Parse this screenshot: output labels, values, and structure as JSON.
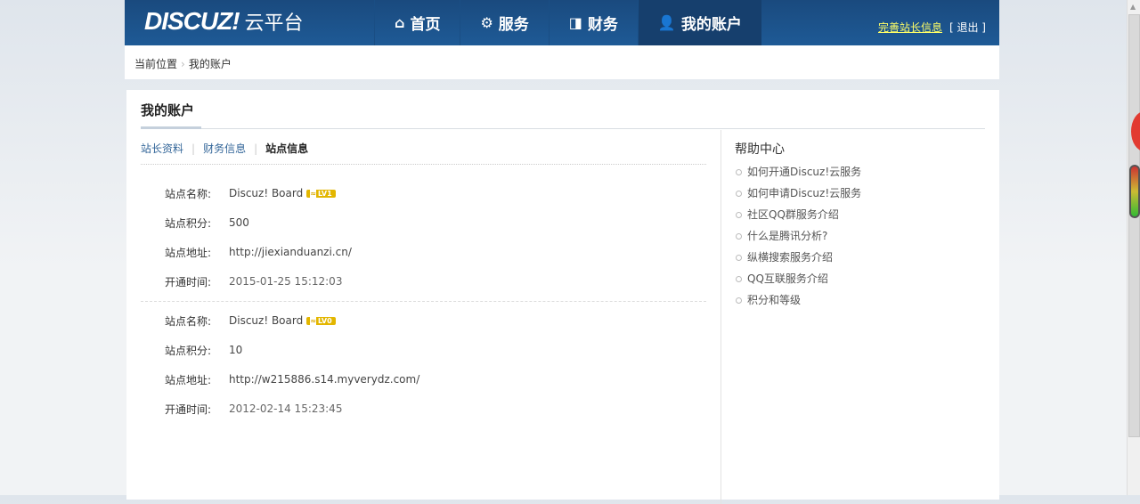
{
  "header": {
    "logo": "DISCUZ!",
    "logo_sub": "云平台",
    "nav": [
      {
        "label": "首页",
        "icon": "home-icon",
        "glyph": "⌂"
      },
      {
        "label": "服务",
        "icon": "gear-icon",
        "glyph": "⚙"
      },
      {
        "label": "财务",
        "icon": "wallet-icon",
        "glyph": "◨"
      },
      {
        "label": "我的账户",
        "icon": "user-icon",
        "glyph": "👤"
      }
    ],
    "complete_info": "完善站长信息",
    "logout": "[ 退出 ]"
  },
  "breadcrumb": {
    "prefix": "当前位置",
    "sep": "›",
    "current": "我的账户"
  },
  "page": {
    "title": "我的账户"
  },
  "tabs": [
    "站长资料",
    "财务信息",
    "站点信息"
  ],
  "labels": {
    "name": "站点名称:",
    "score": "站点积分:",
    "url": "站点地址:",
    "time": "开通时间:"
  },
  "sites": [
    {
      "name": "Discuz! Board",
      "level": "LV1",
      "score": "500",
      "url": "http://jiexianduanzi.cn/",
      "time": "2015-01-25 15:12:03"
    },
    {
      "name": "Discuz! Board",
      "level": "LV0",
      "score": "10",
      "url": "http://w215886.s14.myverydz.com/",
      "time": "2012-02-14 15:23:45"
    }
  ],
  "help": {
    "title": "帮助中心",
    "items": [
      "如何开通Discuz!云服务",
      "如何申请Discuz!云服务",
      "社区QQ群服务介绍",
      "什么是腾讯分析?",
      "纵横搜索服务介绍",
      "QQ互联服务介绍",
      "积分和等级"
    ]
  }
}
